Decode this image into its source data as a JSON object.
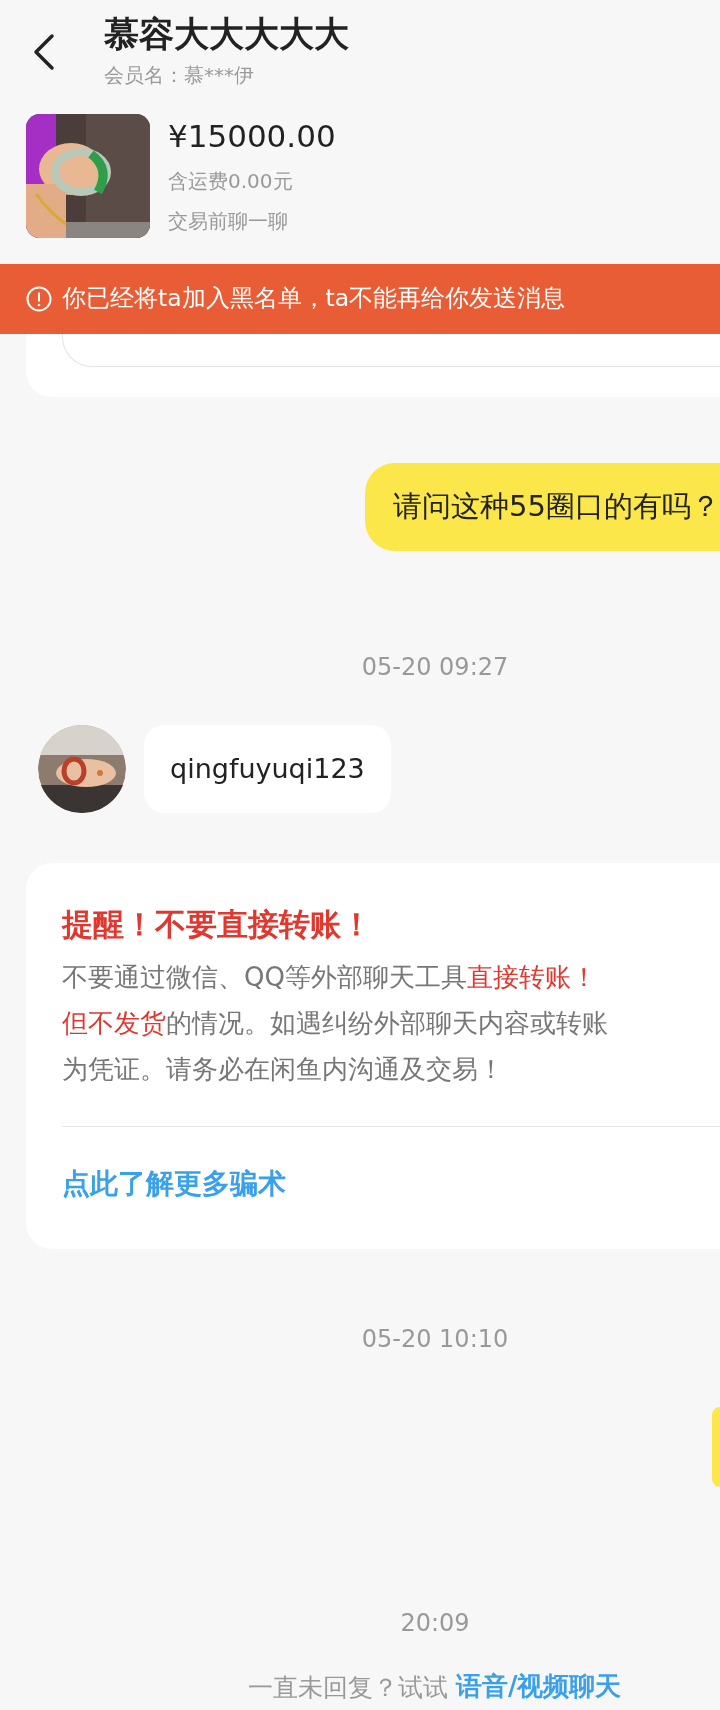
{
  "header": {
    "title": "慕容大大大大大",
    "member": "会员名：慕***伊"
  },
  "product": {
    "price": "¥15000.00",
    "shipping": "含运费0.00元",
    "note": "交易前聊一聊"
  },
  "banner": {
    "text": "你已经将ta加入黑名单，ta不能再给你发送消息"
  },
  "messages": [
    {
      "kind": "outgoing",
      "text": "请问这种55圈口的有吗？"
    },
    {
      "kind": "time",
      "text": "05-20 09:27"
    },
    {
      "kind": "incoming",
      "text": "qingfuyuqi123"
    },
    {
      "kind": "warning",
      "title": "提醒！不要直接转账！",
      "lines": [
        [
          {
            "kind": "normal",
            "text": "不要通过微信、QQ等外部聊天工具"
          },
          {
            "kind": "alert",
            "text": "直接转账！"
          }
        ],
        [
          {
            "kind": "alert",
            "text": "但不发货"
          },
          {
            "kind": "normal",
            "text": "的情况。如遇纠纷外部聊天内容或转账"
          }
        ],
        [
          {
            "kind": "normal",
            "text": "为凭证。请务必在闲鱼内沟通及交易！"
          }
        ]
      ],
      "link": "点此了解更多骗术"
    },
    {
      "kind": "time",
      "text": "05-20 10:10"
    },
    {
      "kind": "outgoing_cut"
    },
    {
      "kind": "time",
      "text": "20:09"
    }
  ],
  "footer": {
    "prompt": "一直未回复？试试",
    "link": "语音/视频聊天"
  }
}
